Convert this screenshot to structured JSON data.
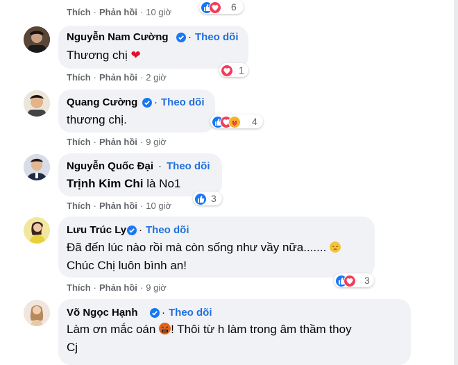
{
  "top_actions": {
    "like": "Thích",
    "reply": "Phản hồi",
    "time": "10 giờ",
    "reaction_count": "6"
  },
  "comments": [
    {
      "name": "Nguyễn Nam Cường",
      "follow": "Theo dõi",
      "text": "Thương chị",
      "actions": {
        "like": "Thích",
        "reply": "Phản hồi",
        "time": "2 giờ"
      },
      "reaction_count": "1"
    },
    {
      "name": "Quang Cường",
      "follow": "Theo dõi",
      "text": "thương chị.",
      "actions": {
        "like": "Thích",
        "reply": "Phản hồi",
        "time": "9 giờ"
      },
      "reaction_count": "4"
    },
    {
      "name": "Nguyễn Quốc Đại",
      "follow": "Theo dõi",
      "text_bold": "Trịnh Kim Chi",
      "text_rest": " là No1",
      "actions": {
        "like": "Thích",
        "reply": "Phản hồi",
        "time": "10 giờ"
      },
      "reaction_count": "3"
    },
    {
      "name": "Lưu Trúc Ly",
      "follow": "Theo dõi",
      "text_line1": "Đã đến lúc nào rồi mà còn sống như vầy nữa.......",
      "text_line2": "Chúc Chị luôn bình an!",
      "actions": {
        "like": "Thích",
        "reply": "Phản hồi",
        "time": "9 giờ"
      },
      "reaction_count": "3"
    },
    {
      "name": "Võ Ngọc Hạnh",
      "follow": "Theo dõi",
      "text_line1a": "Làm ơn mắc oán",
      "text_line1b": "! Thôi từ h làm trong âm thầm thoy",
      "text_line2": "Cj"
    }
  ],
  "separator": "·",
  "colors": {
    "bubble": "#f0f2f5",
    "link": "#216fdb",
    "meta": "#65676b",
    "like_blue": "#1877f2",
    "love_red": "#f33e58"
  }
}
